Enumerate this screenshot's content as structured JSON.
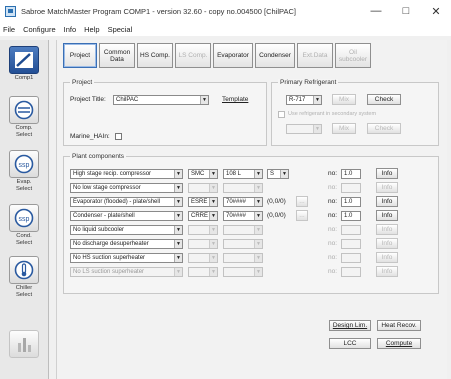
{
  "window": {
    "title": "Sabroe MatchMaster Program COMP1 - version 32.60 - copy no.004500 [ChilPAC]",
    "minimize": "—",
    "maximize": "□",
    "close": "✕"
  },
  "menu": [
    "File",
    "Configure",
    "Info",
    "Help",
    "Special"
  ],
  "sidebar": [
    {
      "label": "Comp1",
      "icon": "compressor-icon"
    },
    {
      "label": "Comp.\nSelect",
      "icon": "compressor-select-icon"
    },
    {
      "label": "Evap.\nSelect",
      "icon": "evaporator-icon"
    },
    {
      "label": "Cond.\nSelect",
      "icon": "condenser-icon"
    },
    {
      "label": "Chiller\nSelect",
      "icon": "chiller-icon"
    },
    {
      "label": "",
      "icon": "chart-icon"
    }
  ],
  "toolbar": [
    {
      "label": "Project",
      "enabled": true
    },
    {
      "label": "Common\nData",
      "enabled": true
    },
    {
      "label": "HS Comp.",
      "enabled": true
    },
    {
      "label": "LS Comp.",
      "enabled": false
    },
    {
      "label": "Evaporator",
      "enabled": true
    },
    {
      "label": "Condenser",
      "enabled": true
    },
    {
      "label": "Ext.Data",
      "enabled": false
    },
    {
      "label": "Oil\nsubcooler",
      "enabled": false
    }
  ],
  "project": {
    "legend": "Project",
    "title_label": "Project Title:",
    "title_value": "ChilPAC",
    "template_button": "Template",
    "marine_label": "Marine_HAIn:"
  },
  "refrigerant": {
    "legend": "Primary Refrigerant",
    "value": "R-717",
    "mix_button": "Mix",
    "check_button": "Check",
    "secondary_label": "Use refrigerant in secondary system",
    "mix2_button": "Mix",
    "check2_button": "Check"
  },
  "plant": {
    "legend": "Plant components",
    "no_label": "no:",
    "info_label": "Info",
    "rows": [
      {
        "name": "High stage recip. compressor",
        "model": "SMC",
        "size": "108 L",
        "type": "S",
        "pct": "",
        "no": "1.0",
        "enabled": true
      },
      {
        "name": "No low stage compressor",
        "model": "",
        "size": "",
        "type": "",
        "pct": "",
        "no": "",
        "enabled": false
      },
      {
        "name": "Evaporator (flooded) - plate/shell",
        "model": "ESRE",
        "size": "70####",
        "type": "",
        "pct": "(0,0/0)",
        "no": "1.0",
        "enabled": true
      },
      {
        "name": "Condenser - plate/shell",
        "model": "CRRE",
        "size": "70####",
        "type": "",
        "pct": "(0,0/0)",
        "no": "1.0",
        "enabled": true
      },
      {
        "name": "No liquid subcooler",
        "model": "",
        "size": "",
        "type": "",
        "pct": "",
        "no": "",
        "enabled": false
      },
      {
        "name": "No discharge desuperheater",
        "model": "",
        "size": "",
        "type": "",
        "pct": "",
        "no": "",
        "enabled": false
      },
      {
        "name": "No HS suction superheater",
        "model": "",
        "size": "",
        "type": "",
        "pct": "",
        "no": "",
        "enabled": false
      },
      {
        "name": "No LS suction superheater",
        "model": "",
        "size": "",
        "type": "",
        "pct": "",
        "no": "",
        "enabled": false
      }
    ]
  },
  "bottom": {
    "design_button": "Design Lim.",
    "heat_button": "Heat Recov.",
    "lcc_button": "LCC",
    "compute_button": "Compute"
  }
}
